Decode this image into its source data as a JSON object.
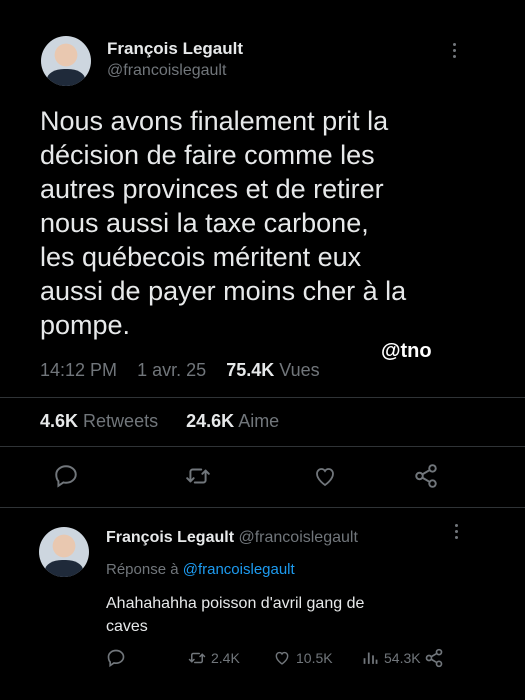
{
  "tweet": {
    "author_name": "François Legault",
    "author_handle": "@francoislegault",
    "text_lines": [
      "Nous avons finalement prit la",
      "décision de faire comme les",
      "autres provinces et de retirer",
      "nous aussi la taxe carbone,",
      "les québecois méritent eux",
      "aussi de payer moins cher à la",
      "pompe."
    ],
    "watermark": "@tno",
    "time": "14:12 PM",
    "date": "1 avr. 25",
    "views_count": "75.4K",
    "views_label": "Vues",
    "retweets_count": "4.6K",
    "retweets_label": "Retweets",
    "likes_count": "24.6K",
    "likes_label": "Aime"
  },
  "reply": {
    "author_name": "François Legault",
    "author_handle": "@francoislegault",
    "replying_prefix": "Réponse à",
    "replying_to": "@francoislegault",
    "text_lines": [
      "Ahahahahha poisson d'avril gang de",
      "caves"
    ],
    "retweets": "2.4K",
    "likes": "10.5K",
    "views": "54.3K"
  },
  "icons": [
    "reply-icon",
    "retweet-icon",
    "like-icon",
    "share-icon",
    "views-icon",
    "more-icon"
  ]
}
